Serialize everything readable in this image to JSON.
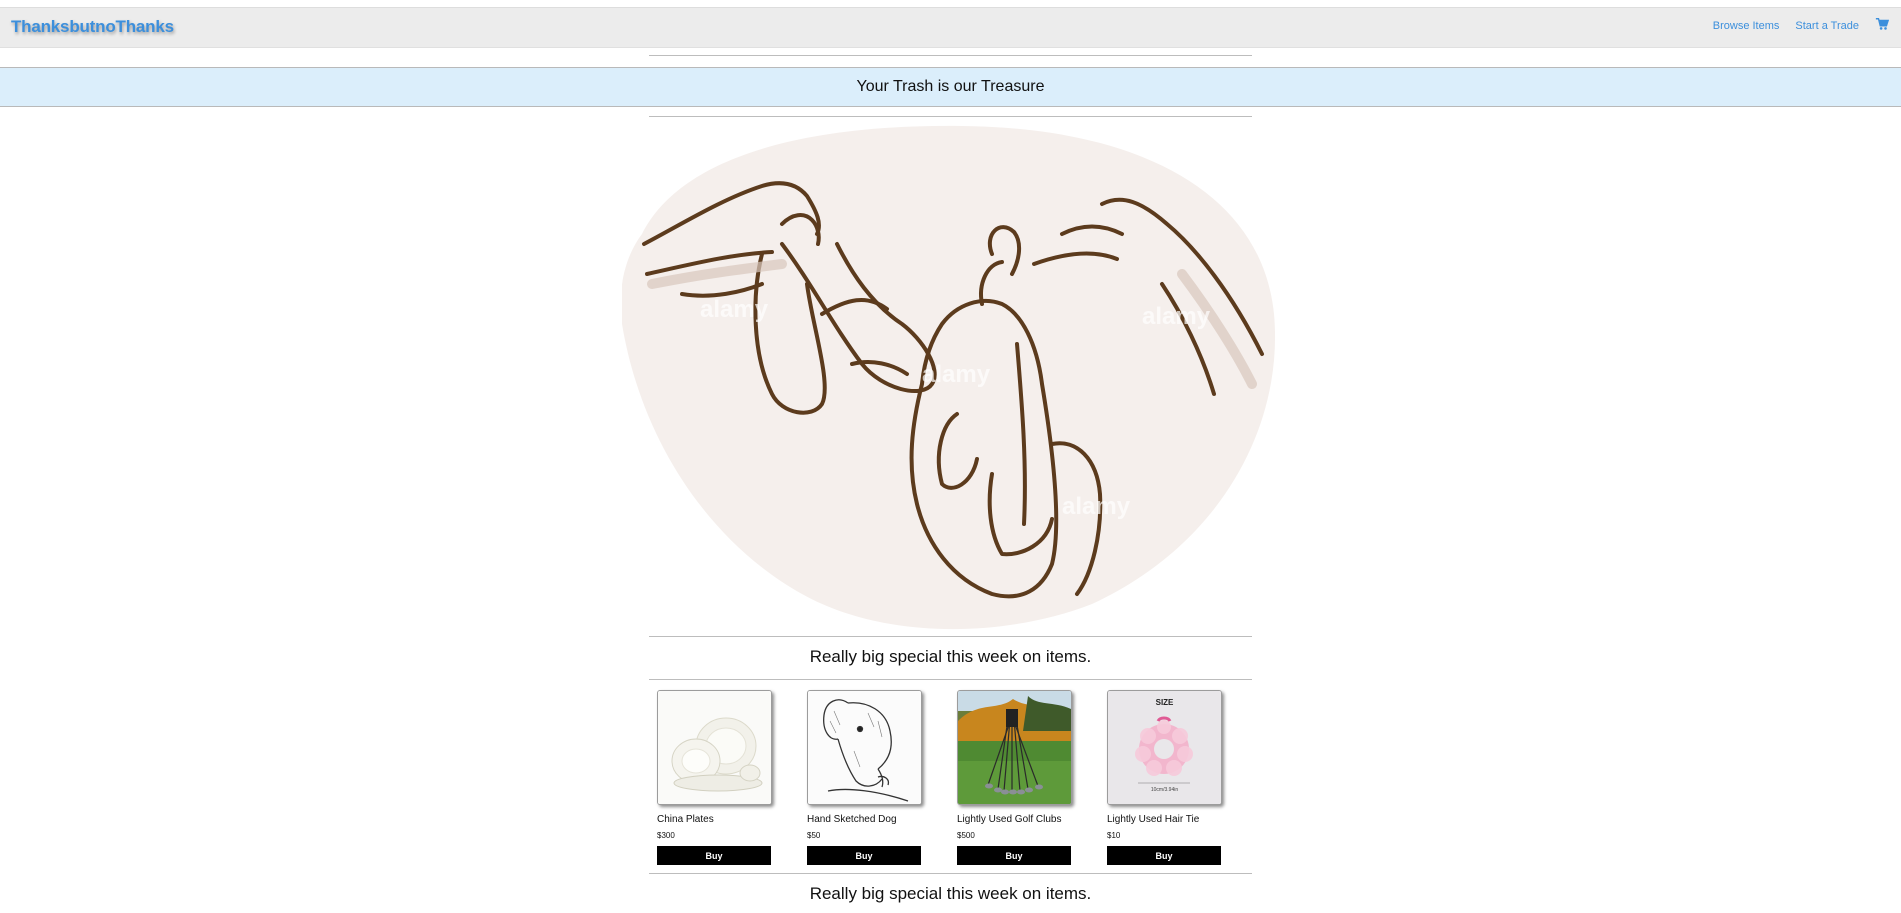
{
  "header": {
    "brand": "ThanksbutnoThanks",
    "nav": {
      "browse_label": "Browse Items",
      "trade_label": "Start a Trade",
      "cart_icon": "cart-icon"
    }
  },
  "tagline": "Your Trash is our Treasure",
  "hero": {
    "watermark": "alamy"
  },
  "special_top": "Really big special this week on items.",
  "products": [
    {
      "name": "China Plates",
      "price": "$300",
      "buy_label": "Buy"
    },
    {
      "name": "Hand Sketched Dog",
      "price": "$50",
      "buy_label": "Buy"
    },
    {
      "name": "Lightly Used Golf Clubs",
      "price": "$500",
      "buy_label": "Buy"
    },
    {
      "name": "Lightly Used Hair Tie",
      "price": "$10",
      "buy_label": "Buy",
      "image_label": "SIZE",
      "image_caption": "10cm/3.94in"
    }
  ],
  "special_bottom": "Really big special this week on items.",
  "colors": {
    "brand": "#3c8fdc",
    "tagline_band": "#dbeefb",
    "buy_button": "#000000",
    "sketch": "#5c3b1d"
  }
}
